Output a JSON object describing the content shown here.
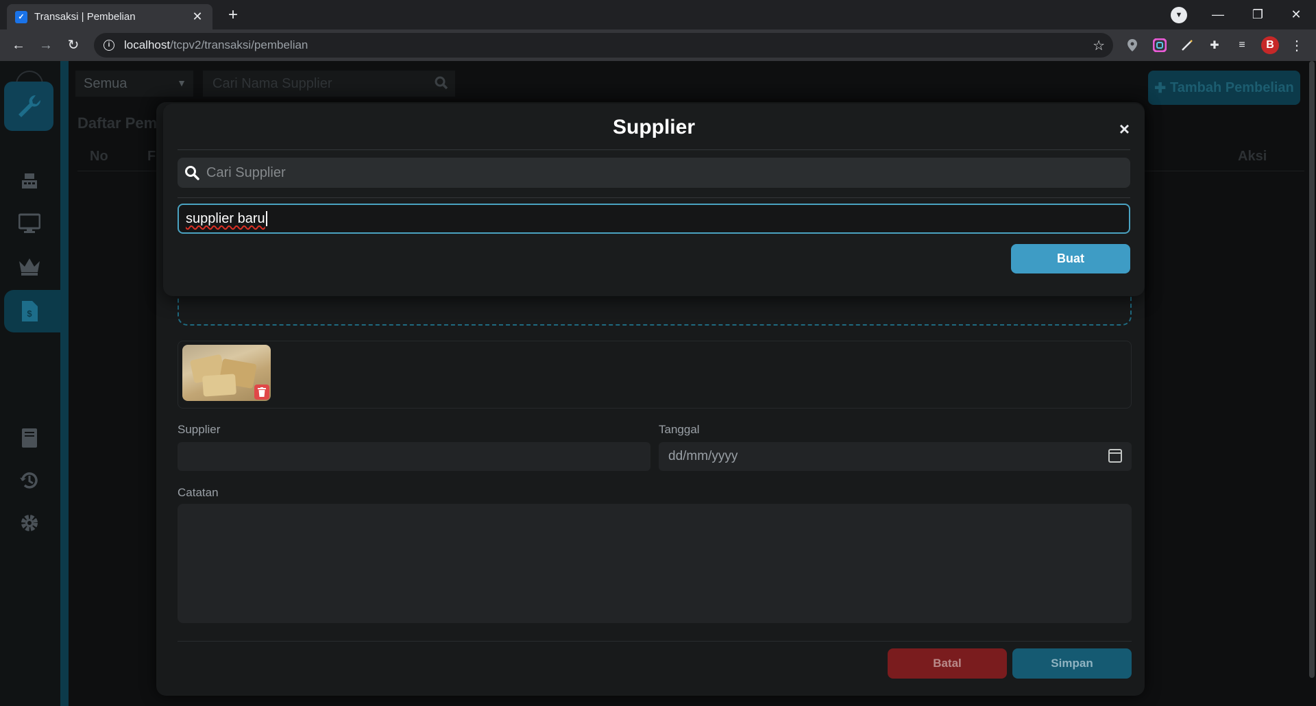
{
  "browser": {
    "tab_title": "Transaksi | Pembelian",
    "tab_close": "✕",
    "new_tab": "+",
    "url_host": "localhost",
    "url_path": "/tcpv2/transaksi/pembelian"
  },
  "page": {
    "filter_select": "Semua",
    "search_placeholder": "Cari Nama Supplier",
    "add_button": "Tambah Pembelian",
    "list_title": "Daftar Pem",
    "columns": {
      "no": "No",
      "f": "Fo",
      "aksi": "Aksi"
    }
  },
  "purchase_form": {
    "supplier_label": "Supplier",
    "date_label": "Tanggal",
    "date_placeholder": "dd/mm/yyyy",
    "notes_label": "Catatan",
    "cancel_button": "Batal",
    "save_button": "Simpan"
  },
  "supplier_modal": {
    "title": "Supplier",
    "close": "×",
    "search_placeholder": "Cari Supplier",
    "new_supplier_value": "supplier baru",
    "create_button": "Buat"
  },
  "colors": {
    "accent": "#3e9cc5",
    "danger": "#7a1c1e",
    "sidebar_active": "#0c3a4a"
  }
}
